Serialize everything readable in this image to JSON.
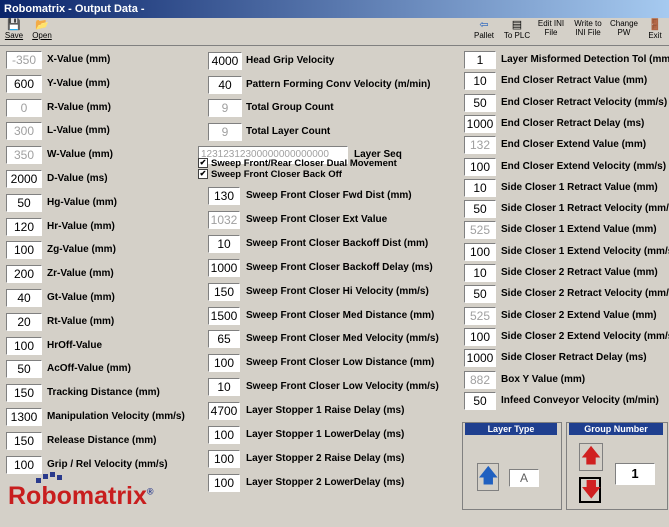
{
  "window": {
    "title": "Robomatrix - Output Data -"
  },
  "toolbar": {
    "save": "Save",
    "open": "Open",
    "pallet": "Pallet",
    "to_plc": "To PLC",
    "edit_ini": "Edit INI File",
    "write_ini": "Write to INI File",
    "change_pw": "Change PW",
    "exit": "Exit"
  },
  "col1": [
    {
      "value": "-350",
      "label": "X-Value (mm)",
      "disabled": true
    },
    {
      "value": "600",
      "label": "Y-Value (mm)",
      "disabled": false
    },
    {
      "value": "0",
      "label": "R-Value (mm)",
      "disabled": true
    },
    {
      "value": "300",
      "label": "L-Value (mm)",
      "disabled": true
    },
    {
      "value": "350",
      "label": "W-Value (mm)",
      "disabled": true
    },
    {
      "value": "2000",
      "label": "D-Value (ms)",
      "disabled": false
    },
    {
      "value": "50",
      "label": "Hg-Value (mm)",
      "disabled": false
    },
    {
      "value": "120",
      "label": "Hr-Value (mm)",
      "disabled": false
    },
    {
      "value": "100",
      "label": "Zg-Value (mm)",
      "disabled": false
    },
    {
      "value": "200",
      "label": "Zr-Value (mm)",
      "disabled": false
    },
    {
      "value": "40",
      "label": "Gt-Value (mm)",
      "disabled": false
    },
    {
      "value": "20",
      "label": "Rt-Value (mm)",
      "disabled": false
    },
    {
      "value": "100",
      "label": "HrOff-Value",
      "disabled": false
    },
    {
      "value": "50",
      "label": "AcOff-Value (mm)",
      "disabled": false
    },
    {
      "value": "150",
      "label": "Tracking Distance (mm)",
      "disabled": false
    },
    {
      "value": "1300",
      "label": "Manipulation Velocity (mm/s)",
      "disabled": false
    },
    {
      "value": "150",
      "label": "Release Distance (mm)",
      "disabled": false
    },
    {
      "value": "100",
      "label": "Grip / Rel Velocity (mm/s)",
      "disabled": false
    }
  ],
  "col2_top": [
    {
      "value": "4000",
      "label": "Head Grip Velocity",
      "disabled": false
    },
    {
      "value": "40",
      "label": "Pattern Forming Conv Velocity (m/min)",
      "disabled": false
    },
    {
      "value": "9",
      "label": "Total Group Count",
      "disabled": true
    },
    {
      "value": "9",
      "label": "Total Layer Count",
      "disabled": true
    }
  ],
  "layer_seq": {
    "value": "12312312300000000000000",
    "label": "Layer Seq"
  },
  "checkboxes": [
    {
      "label": "Sweep Front/Rear Closer Dual Movement",
      "checked": "✔"
    },
    {
      "label": "Sweep Front Closer Back Off",
      "checked": "✔"
    }
  ],
  "col2_bottom": [
    {
      "value": "130",
      "label": "Sweep Front Closer Fwd  Dist (mm)",
      "disabled": false
    },
    {
      "value": "1032",
      "label": "Sweep Front Closer Ext Value",
      "disabled": true
    },
    {
      "value": "10",
      "label": "Sweep Front Closer Backoff Dist (mm)",
      "disabled": false
    },
    {
      "value": "1000",
      "label": "Sweep Front Closer Backoff Delay (ms)",
      "disabled": false
    },
    {
      "value": "150",
      "label": "Sweep Front Closer Hi Velocity (mm/s)",
      "disabled": false
    },
    {
      "value": "1500",
      "label": "Sweep Front Closer Med Distance (mm)",
      "disabled": false
    },
    {
      "value": "65",
      "label": "Sweep Front Closer Med Velocity (mm/s)",
      "disabled": false
    },
    {
      "value": "100",
      "label": "Sweep Front Closer Low Distance (mm)",
      "disabled": false
    },
    {
      "value": "10",
      "label": "Sweep Front Closer Low Velocity (mm/s)",
      "disabled": false
    },
    {
      "value": "4700",
      "label": "Layer Stopper 1 Raise Delay (ms)",
      "disabled": false
    },
    {
      "value": "100",
      "label": "Layer Stopper 1 LowerDelay (ms)",
      "disabled": false
    },
    {
      "value": "100",
      "label": "Layer Stopper 2 Raise Delay (ms)",
      "disabled": false
    },
    {
      "value": "100",
      "label": "Layer Stopper 2 LowerDelay (ms)",
      "disabled": false
    }
  ],
  "col3": [
    {
      "value": "1",
      "label": "Layer Misformed Detection Tol (mm)",
      "disabled": false
    },
    {
      "value": "10",
      "label": "End Closer Retract Value (mm)",
      "disabled": false
    },
    {
      "value": "50",
      "label": "End Closer Retract Velocity (mm/s)",
      "disabled": false
    },
    {
      "value": "1000",
      "label": "End Closer Retract Delay (ms)",
      "disabled": false
    },
    {
      "value": "132",
      "label": "End Closer Extend Value (mm)",
      "disabled": true
    },
    {
      "value": "100",
      "label": "End Closer Extend Velocity (mm/s)",
      "disabled": false
    },
    {
      "value": "10",
      "label": "Side Closer 1 Retract Value (mm)",
      "disabled": false
    },
    {
      "value": "50",
      "label": "Side Closer 1 Retract Velocity (mm/s)",
      "disabled": false
    },
    {
      "value": "525",
      "label": "Side Closer 1 Extend Value (mm)",
      "disabled": true
    },
    {
      "value": "100",
      "label": "Side Closer 1 Extend Velocity (mm/s)",
      "disabled": false
    },
    {
      "value": "10",
      "label": "Side Closer 2 Retract Value (mm)",
      "disabled": false
    },
    {
      "value": "50",
      "label": "Side Closer 2 Retract Velocity (mm/s)",
      "disabled": false
    },
    {
      "value": "525",
      "label": "Side Closer 2 Extend Value (mm)",
      "disabled": true
    },
    {
      "value": "100",
      "label": "Side Closer 2 Extend Velocity (mm/s)",
      "disabled": false
    },
    {
      "value": "1000",
      "label": "Side Closer Retract Delay (ms)",
      "disabled": false
    },
    {
      "value": "882",
      "label": "Box Y Value (mm)",
      "disabled": true
    },
    {
      "value": "50",
      "label": "Infeed Conveyor Velocity (m/min)",
      "disabled": false
    }
  ],
  "layer_type": {
    "title": "Layer Type",
    "value": "A"
  },
  "group_number": {
    "title": "Group Number",
    "value": "1"
  },
  "logo": {
    "text": "Robomatrix",
    "sub": "®"
  },
  "colors": {
    "title_bar": "#0a246a",
    "group_header": "#1f3f8f",
    "up_arrow": "#2060c0",
    "red_arrow": "#d02020",
    "logo_red": "#c81e1e",
    "logo_blue": "#2a3a8c"
  }
}
